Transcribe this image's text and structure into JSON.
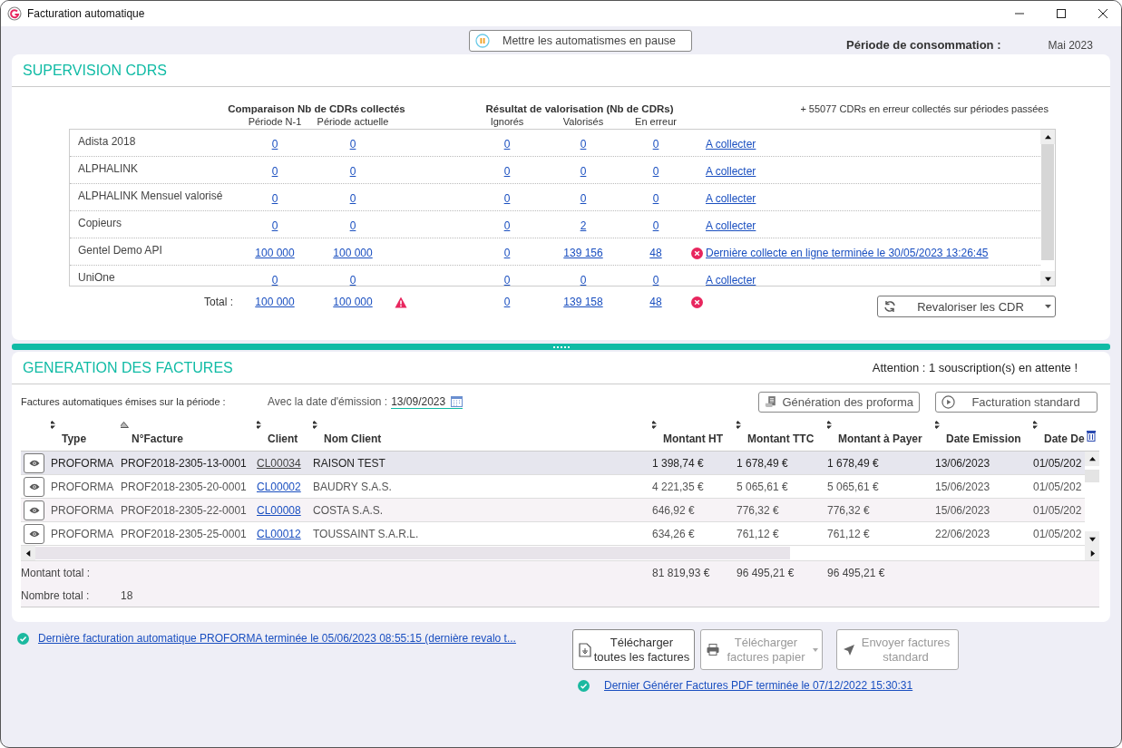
{
  "window": {
    "title": "Facturation automatique"
  },
  "pause_button": {
    "label": "Mettre les automatismes en pause"
  },
  "period": {
    "label": "Période de consommation :",
    "value": "Mai 2023"
  },
  "supervision": {
    "title": "SUPERVISION CDRS",
    "group_headers": [
      "Comparaison Nb de CDRs collectés",
      "Résultat de valorisation (Nb de CDRs)"
    ],
    "past_errors_note": "+ 55077 CDRs en erreur collectés sur périodes passées",
    "columns": [
      "Période N-1",
      "Période actuelle",
      "Ignorés",
      "Valorisés",
      "En erreur"
    ],
    "rows": [
      {
        "name": "Adista 2018",
        "previous": "0",
        "current": "0",
        "ignored": "0",
        "valued": "0",
        "errors": "0",
        "error": false,
        "status": "A collecter"
      },
      {
        "name": "ALPHALINK",
        "previous": "0",
        "current": "0",
        "ignored": "0",
        "valued": "0",
        "errors": "0",
        "error": false,
        "status": "A collecter"
      },
      {
        "name": "ALPHALINK Mensuel valorisé",
        "previous": "0",
        "current": "0",
        "ignored": "0",
        "valued": "0",
        "errors": "0",
        "error": false,
        "status": "A collecter"
      },
      {
        "name": "Copieurs",
        "previous": "0",
        "current": "0",
        "ignored": "0",
        "valued": "2",
        "errors": "0",
        "error": false,
        "status": "A collecter"
      },
      {
        "name": "Gentel Demo API",
        "previous": "100 000",
        "current": "100 000",
        "ignored": "0",
        "valued": "139 156",
        "errors": "48",
        "error": true,
        "status": "Dernière collecte en ligne terminée le 30/05/2023 13:26:45"
      },
      {
        "name": "UniOne",
        "previous": "0",
        "current": "0",
        "ignored": "0",
        "valued": "0",
        "errors": "0",
        "error": false,
        "status": "A collecter"
      }
    ],
    "total": {
      "label": "Total :",
      "previous": "100 000",
      "current": "100 000",
      "warning": true,
      "ignored": "0",
      "valued": "139 158",
      "errors": "48",
      "error": true
    },
    "revalue_button": {
      "label": "Revaloriser les CDR"
    }
  },
  "invoices": {
    "title": "GENERATION DES FACTURES",
    "warning": "Attention : 1 souscription(s) en attente !",
    "filter_label": "Factures automatiques émises sur la période :",
    "date_field": {
      "label": "Avec la date d'émission :",
      "value": "13/09/2023"
    },
    "buttons": [
      {
        "label": "Génération des proforma",
        "kind": "proforma"
      },
      {
        "label": "Facturation standard",
        "kind": "standard"
      }
    ],
    "columns": [
      {
        "label": "Type",
        "sorted": false
      },
      {
        "label": "N°Facture",
        "sorted": true
      },
      {
        "label": "Client",
        "sorted": false
      },
      {
        "label": "Nom Client",
        "sorted": false
      },
      {
        "label": "Montant HT",
        "sorted": false
      },
      {
        "label": "Montant TTC",
        "sorted": false
      },
      {
        "label": "Montant à Payer",
        "sorted": false
      },
      {
        "label": "Date Emission",
        "sorted": false
      },
      {
        "label": "Date De",
        "sorted": false
      }
    ],
    "rows": [
      {
        "type": "PROFORMA",
        "number": "PROF2018-2305-13-0001",
        "client": "CL00034",
        "name": "RAISON TEST",
        "ht": "1 398,74 €",
        "ttc": "1 678,49 €",
        "pay": "1 678,49 €",
        "emission": "13/06/2023",
        "date_de": "01/05/202",
        "selected": true
      },
      {
        "type": "PROFORMA",
        "number": "PROF2018-2305-20-0001",
        "client": "CL00002",
        "name": "BAUDRY S.A.S.",
        "ht": "4 221,35 €",
        "ttc": "5 065,61 €",
        "pay": "5 065,61 €",
        "emission": "15/06/2023",
        "date_de": "01/05/202",
        "selected": false
      },
      {
        "type": "PROFORMA",
        "number": "PROF2018-2305-22-0001",
        "client": "CL00008",
        "name": "COSTA S.A.S.",
        "ht": "646,92 €",
        "ttc": "776,32 €",
        "pay": "776,32 €",
        "emission": "15/06/2023",
        "date_de": "01/05/202",
        "selected": false
      },
      {
        "type": "PROFORMA",
        "number": "PROF2018-2305-25-0001",
        "client": "CL00012",
        "name": "TOUSSAINT S.A.R.L.",
        "ht": "634,26 €",
        "ttc": "761,12 €",
        "pay": "761,12 €",
        "emission": "22/06/2023",
        "date_de": "01/05/202",
        "selected": false
      }
    ],
    "totals": {
      "amount_label": "Montant total :",
      "ht": "81 819,93 €",
      "ttc": "96 495,21 €",
      "pay": "96 495,21 €",
      "count_label": "Nombre total :",
      "count": "18"
    }
  },
  "footer": {
    "last_run_link": "Dernière facturation automatique PROFORMA terminée le 05/06/2023 08:55:15 (dernière revalo t...",
    "buttons": [
      {
        "label": "Télécharger\ntoutes les factures",
        "kind": "download",
        "disabled": false,
        "dropdown": false
      },
      {
        "label": "Télécharger\nfactures papier",
        "kind": "print",
        "disabled": true,
        "dropdown": true
      },
      {
        "label": "Envoyer factures\nstandard",
        "kind": "send",
        "disabled": true,
        "dropdown": false
      }
    ],
    "last_pdf_link": "Dernier Générer Factures PDF terminée le 07/12/2022 15:30:31"
  }
}
